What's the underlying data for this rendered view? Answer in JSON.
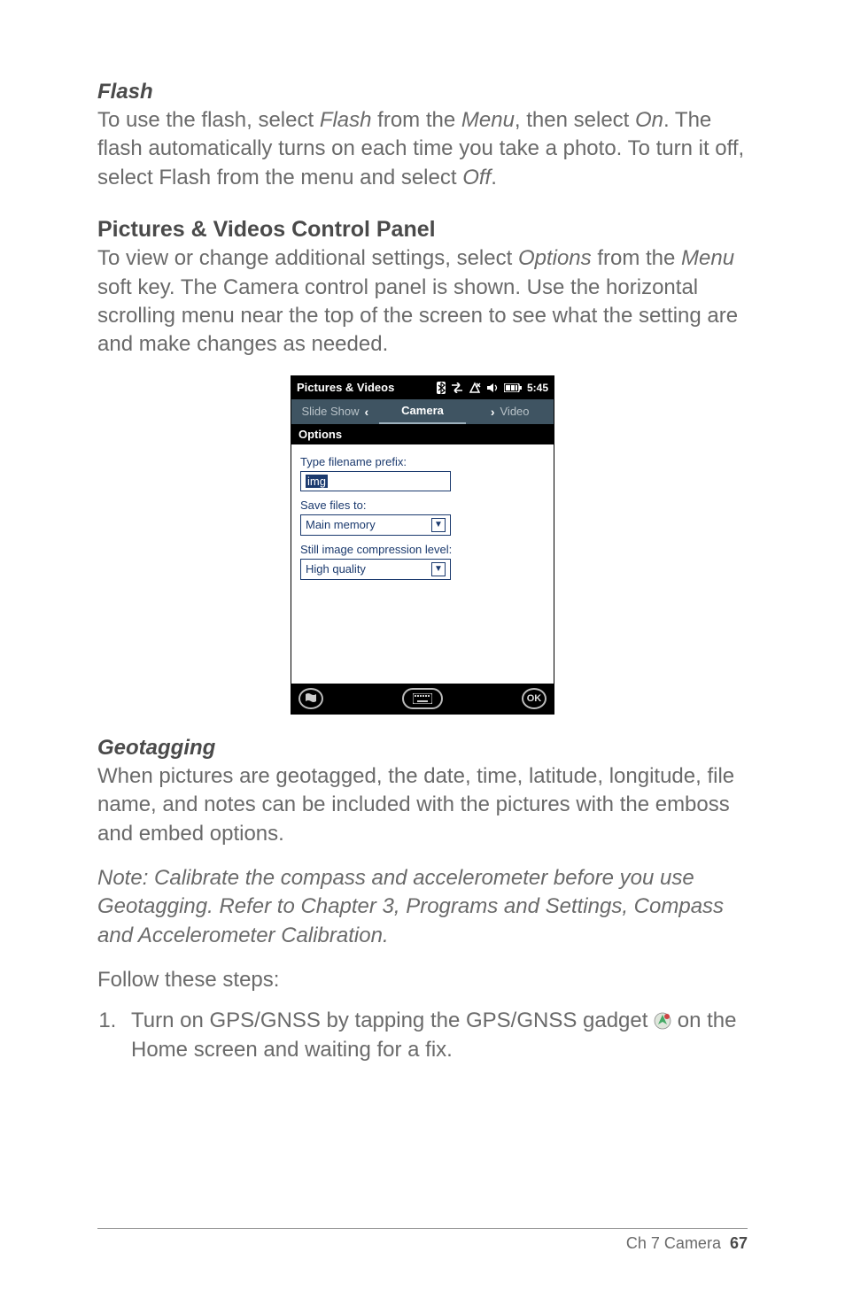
{
  "flash": {
    "heading": "Flash",
    "body_pre": "To use the flash, select ",
    "menu_word1": "Flash",
    "body_mid1": " from the ",
    "menu_word2": "Menu",
    "body_mid2": ", then select ",
    "on_word": "On",
    "body_mid3": ". The flash automatically turns on each time you take a photo. To turn it off, select Flash from the menu and select ",
    "off_word": "Off",
    "body_end": "."
  },
  "panel": {
    "heading": "Pictures & Videos Control Panel",
    "body_pre": "To view or change additional settings, select ",
    "options_word": "Options",
    "body_mid1": " from the ",
    "menu_word": "Menu",
    "body_mid2": " soft key. The Camera control panel is shown. Use the horizontal scrolling menu near the top of the screen to see what the setting are and make changes as needed."
  },
  "screenshot": {
    "title": "Pictures & Videos",
    "clock": "5:45",
    "tabs": {
      "left": "Slide Show",
      "center": "Camera",
      "right": "Video"
    },
    "subhead": "Options",
    "labels": {
      "prefix": "Type filename prefix:",
      "saveto": "Save files to:",
      "compress": "Still image compression level:"
    },
    "values": {
      "prefix": "img",
      "saveto": "Main memory",
      "compress": "High quality"
    },
    "ok": "OK"
  },
  "geotag": {
    "heading": "Geotagging",
    "body": "When pictures are geotagged, the date, time, latitude, longitude, file name, and notes can be included with the pictures with the emboss and embed options.",
    "note": "Note: Calibrate the compass and accelerometer before you use Geotagging. Refer to Chapter 3, Programs and Settings, Compass and Accelerometer Calibration.",
    "follow": "Follow these steps:",
    "step1_pre": "Turn on GPS/GNSS by tapping the GPS/GNSS gadget ",
    "step1_post": " on the Home screen and waiting for a fix."
  },
  "footer": {
    "chapter": "Ch 7   Camera",
    "page": "67"
  }
}
